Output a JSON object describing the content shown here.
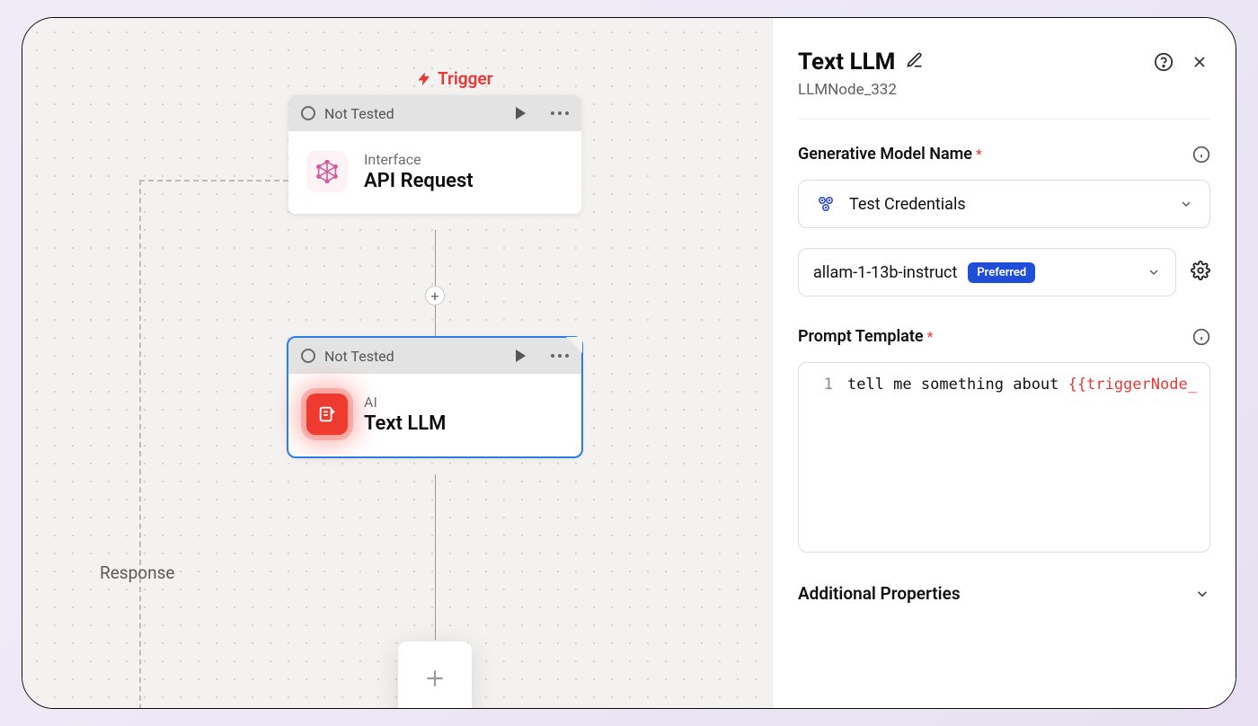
{
  "canvas": {
    "trigger_label": "Trigger",
    "response_label": "Response",
    "nodes": {
      "n1": {
        "status": "Not Tested",
        "category": "Interface",
        "title": "API Request"
      },
      "n2": {
        "status": "Not Tested",
        "category": "AI",
        "title": "Text LLM"
      }
    }
  },
  "panel": {
    "title": "Text LLM",
    "subtitle": "LLMNode_332",
    "section_model": "Generative Model Name",
    "credentials": "Test Credentials",
    "model_name": "allam-1-13b-instruct",
    "model_badge": "Preferred",
    "section_prompt": "Prompt Template",
    "editor": {
      "line_number": "1",
      "text": "tell me something about ",
      "variable": "{{triggerNode_"
    },
    "additional": "Additional Properties"
  }
}
